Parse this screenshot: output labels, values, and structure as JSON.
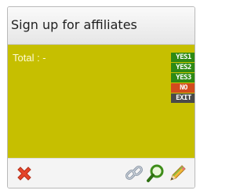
{
  "widget": {
    "title": "Sign up for affiliates",
    "total_label": "Total : -",
    "tags": [
      {
        "label": "YES1",
        "kind": "yes"
      },
      {
        "label": "YES2",
        "kind": "yes"
      },
      {
        "label": "YES3",
        "kind": "yes"
      },
      {
        "label": "NO",
        "kind": "no"
      },
      {
        "label": "EXIT",
        "kind": "exit"
      }
    ]
  },
  "footer": {
    "icons": [
      "close-icon",
      "link-icon",
      "search-icon",
      "edit-icon"
    ]
  },
  "colors": {
    "body_background": "#c6bf00",
    "yes_tag": "#2e8a14",
    "no_tag": "#d24b1e",
    "exit_tag": "#4a4a4a",
    "close_icon": "#e5452a"
  }
}
